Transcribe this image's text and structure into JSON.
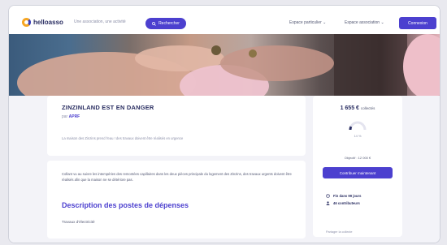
{
  "header": {
    "logo_text": "helloasso",
    "search_placeholder": "Une association, une activité",
    "search_button": "Rechercher",
    "nav_particuliers": "Espace particulier",
    "nav_associations": "Espace association",
    "connect_button": "Connexion"
  },
  "campaign": {
    "title": "ZINZINLAND EST EN DANGER",
    "by_prefix": "par",
    "organizer": "APRF",
    "intro": "La maison des Zinzins prend l'eau ! des travaux doivent être réalisés en urgence",
    "description": "Collant vu au suivre les intempéries des remontées capillaires dans les deux pièces principale du logement des Zinzins, des travaux urgents doivent être réalisés afin que la maison ne se détériore pas.",
    "section_title": "Description des postes de dépenses",
    "subsection": "Travaux d'électricité"
  },
  "sidebar": {
    "amount": "1 655 €",
    "amount_label": "collectés",
    "progress_label": "14 %",
    "progress_fraction": 0.14,
    "goal_text": "Objectif : 12 000 €",
    "contribute_button": "Contribuer maintenant",
    "days_left": "Fin dans 99 jours",
    "contributors": "46 contributeurs",
    "share": "Partager la collecte"
  },
  "colors": {
    "brand": "#4c40cf",
    "title": "#2a2e62",
    "logo_accent": "#f6a623"
  }
}
